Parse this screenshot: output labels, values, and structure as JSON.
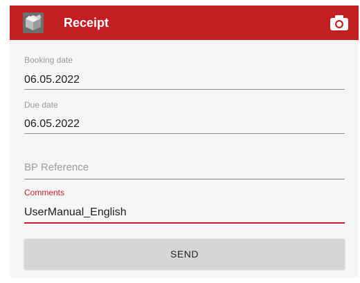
{
  "app_bar": {
    "title": "Receipt",
    "logo_icon": "box-logo-icon",
    "action_icon": "camera-icon",
    "color": "#c21f24"
  },
  "form": {
    "booking_date": {
      "label": "Booking date",
      "value": "06.05.2022"
    },
    "due_date": {
      "label": "Due date",
      "value": "06.05.2022"
    },
    "bp_reference": {
      "placeholder": "BP Reference",
      "value": ""
    },
    "comments": {
      "label": "Comments",
      "value": "UserManual_English",
      "focused": true
    }
  },
  "actions": {
    "send_label": "SEND"
  }
}
